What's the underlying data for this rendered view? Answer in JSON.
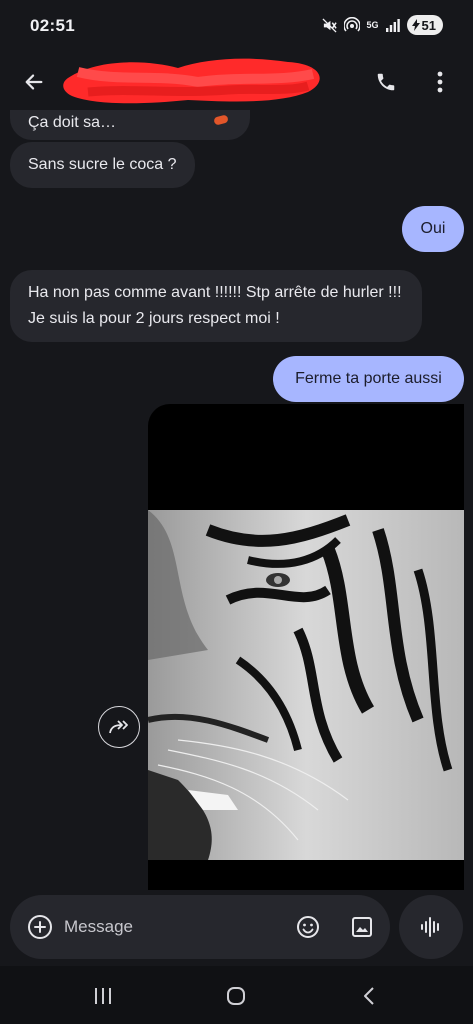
{
  "status_bar": {
    "time": "02:51",
    "network": "5G",
    "battery": "51"
  },
  "header": {
    "contact_name": ""
  },
  "messages": [
    {
      "direction": "in",
      "text": "Ça doit sa…"
    },
    {
      "direction": "in",
      "text": "Sans sucre le coca ?"
    },
    {
      "direction": "out",
      "text": "Oui"
    },
    {
      "direction": "in",
      "text": "Ha non pas comme avant !!!!!! Stp arrête de hurler !!! Je suis la pour 2 jours respect moi !"
    },
    {
      "direction": "out",
      "text": "Ferme ta porte aussi"
    },
    {
      "direction": "out",
      "type": "image",
      "subject": "tiger"
    }
  ],
  "composer": {
    "placeholder": "Message"
  },
  "icons": {
    "back": "arrow-back-icon",
    "call": "phone-icon",
    "more": "more-vert-icon",
    "share": "share-arrow-icon",
    "add": "plus-circle-icon",
    "emoji": "emoji-icon",
    "gallery": "image-icon",
    "voice": "voice-wave-icon"
  },
  "colors": {
    "background": "#16171b",
    "incoming_bubble": "#26272d",
    "outgoing_bubble": "#a7b6ff",
    "redaction": "#ff2a2a"
  }
}
